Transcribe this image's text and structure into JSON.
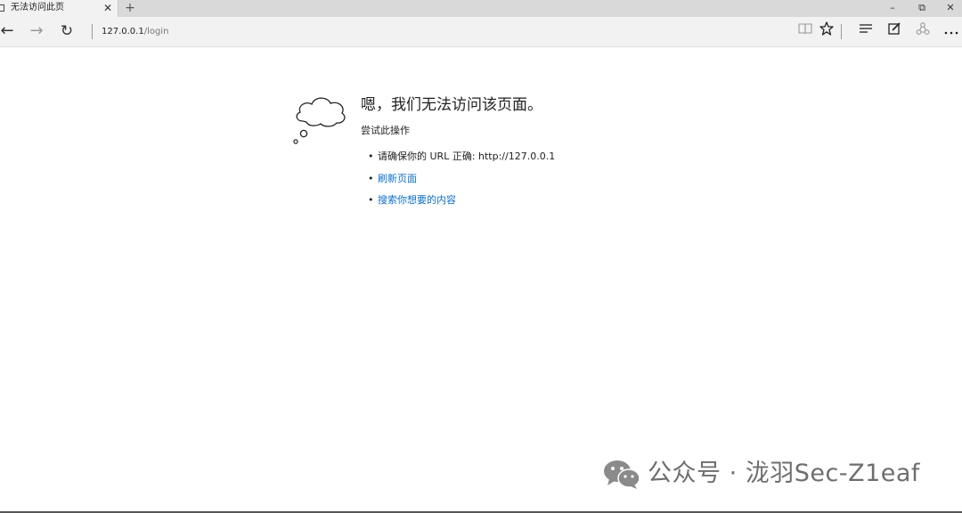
{
  "tab": {
    "title": "无法访问此页",
    "close_glyph": "✕",
    "new_tab_glyph": "+"
  },
  "window_controls": {
    "minimize": "–",
    "maximize": "⧉",
    "close": "✕"
  },
  "toolbar": {
    "back_glyph": "←",
    "forward_glyph": "→",
    "refresh_glyph": "↻",
    "address_host": "127.0.0.1",
    "address_path": "/login",
    "icons": [
      "reading-view-icon",
      "favorite-star-icon",
      "hub-icon",
      "web-note-icon",
      "share-icon",
      "more-icon"
    ]
  },
  "error_page": {
    "title": "嗯，我们无法访问该页面。",
    "subtitle": "尝试此操作",
    "items": [
      {
        "text": "请确保你的 URL 正确: http://127.0.0.1",
        "link": false
      },
      {
        "text": "刷新页面",
        "link": true
      },
      {
        "text": "搜索你想要的内容",
        "link": true
      }
    ],
    "bullet": "•",
    "link_color": "#0f6fc6"
  },
  "watermark": {
    "text": "公众号 · 泷羽Sec-Z1eaf"
  }
}
